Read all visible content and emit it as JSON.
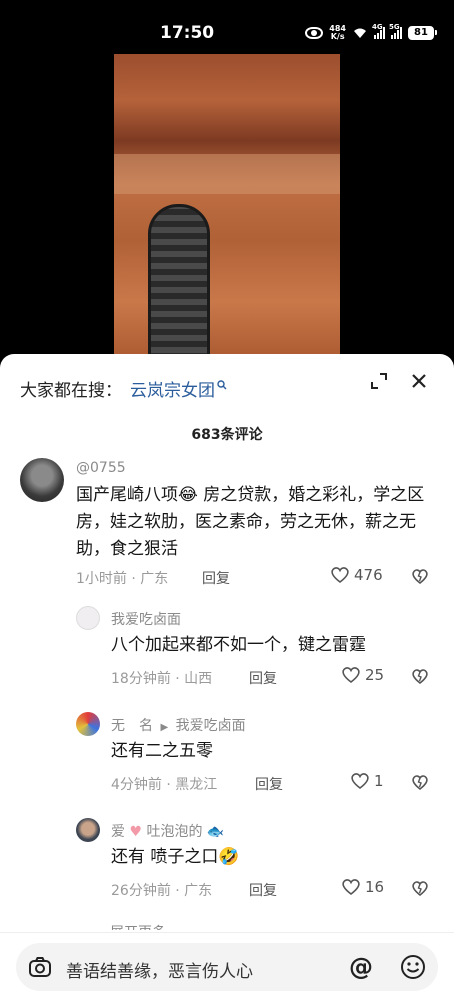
{
  "status": {
    "time": "17:50",
    "speed_value": "484",
    "speed_unit": "K/s",
    "signal_1": "4G",
    "signal_2": "5G",
    "battery": "81"
  },
  "sheet": {
    "search_prefix": "大家都在搜：",
    "search_term": "云岚宗女团",
    "comment_count": "683条评论"
  },
  "comments": [
    {
      "name": "@0755",
      "text": "国产尾崎八项😂 房之贷款，婚之彩礼，学之区房，娃之软肋，医之素命，劳之无休，薪之无助，食之狠活",
      "time": "1小时前",
      "location": "· 广东",
      "reply_label": "回复",
      "likes": "476"
    },
    {
      "name": "我爱吃卤面",
      "text": "八个加起来都不如一个，键之雷霆",
      "time": "18分钟前",
      "location": "· 山西",
      "reply_label": "回复",
      "likes": "25"
    },
    {
      "name": "无　名",
      "reply_to": "我爱吃卤面",
      "text": "还有二之五零",
      "time": "4分钟前",
      "location": "· 黑龙江",
      "reply_label": "回复",
      "likes": "1"
    },
    {
      "name": "爱",
      "name_2": "吐泡泡的",
      "text": "还有 喷子之口🤣",
      "time": "26分钟前",
      "location": "· 广东",
      "reply_label": "回复",
      "likes": "16"
    }
  ],
  "expand_more": "展开更多",
  "input": {
    "placeholder": "善语结善缘，恶言伤人心",
    "at": "@"
  },
  "colors": {
    "link_blue": "#2b5d9c",
    "sheet_bg": "#ffffff",
    "input_bg": "#f3f3f3"
  }
}
